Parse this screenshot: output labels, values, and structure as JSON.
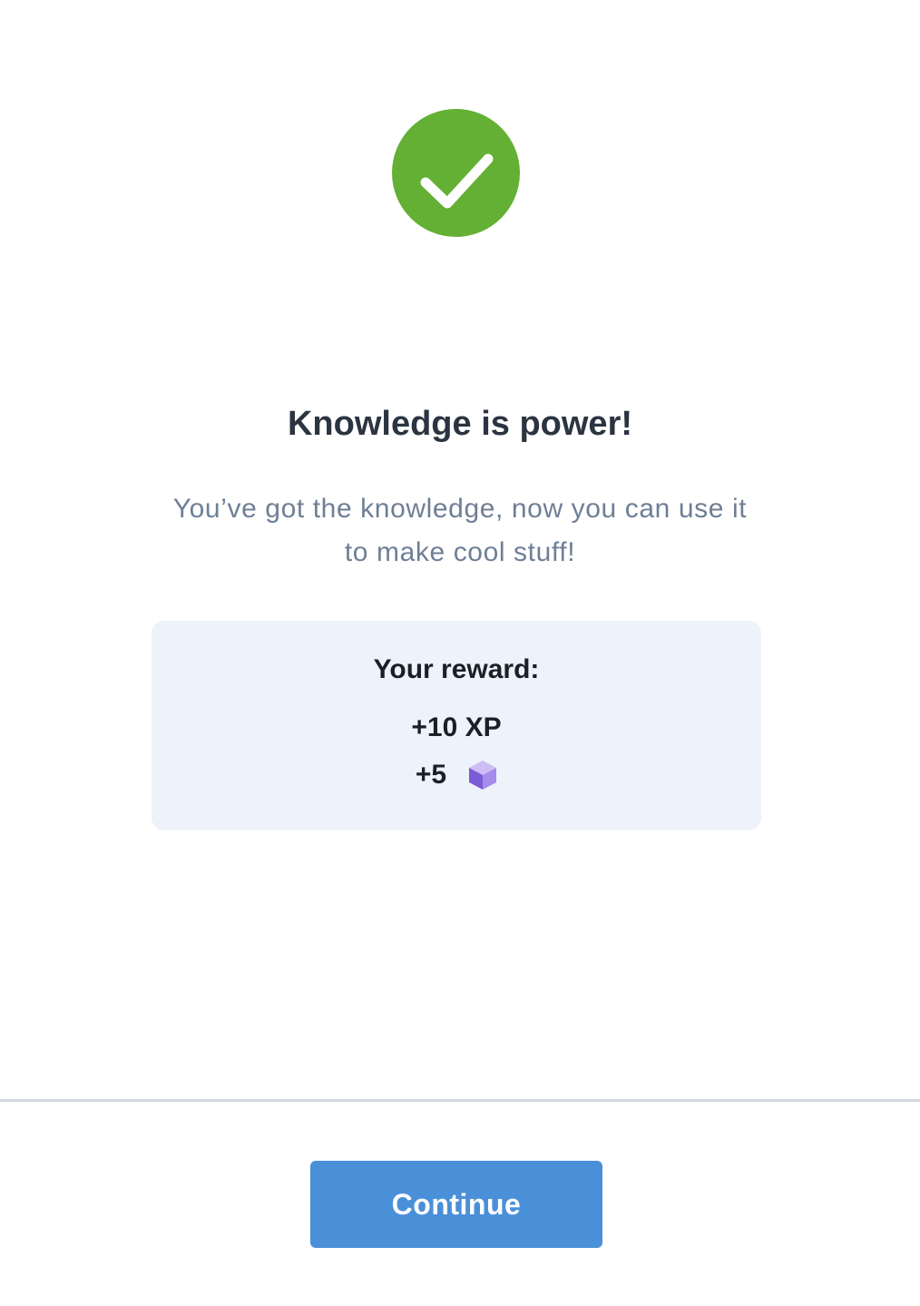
{
  "header": {
    "status_icon": "checkmark-icon",
    "status_color": "#63b034"
  },
  "content": {
    "title": "Knowledge is power!",
    "subtitle_line1": "You’ve got the knowledge, now you can use it",
    "subtitle_line2": "to make cool stuff!"
  },
  "reward": {
    "heading": "Your reward:",
    "xp": "+10 XP",
    "gems": "+5",
    "gem_icon": "gem-cube-icon",
    "gem_color": "#8c6ee0"
  },
  "footer": {
    "continue_label": "Continue",
    "accent_color": "#4a90d9"
  }
}
